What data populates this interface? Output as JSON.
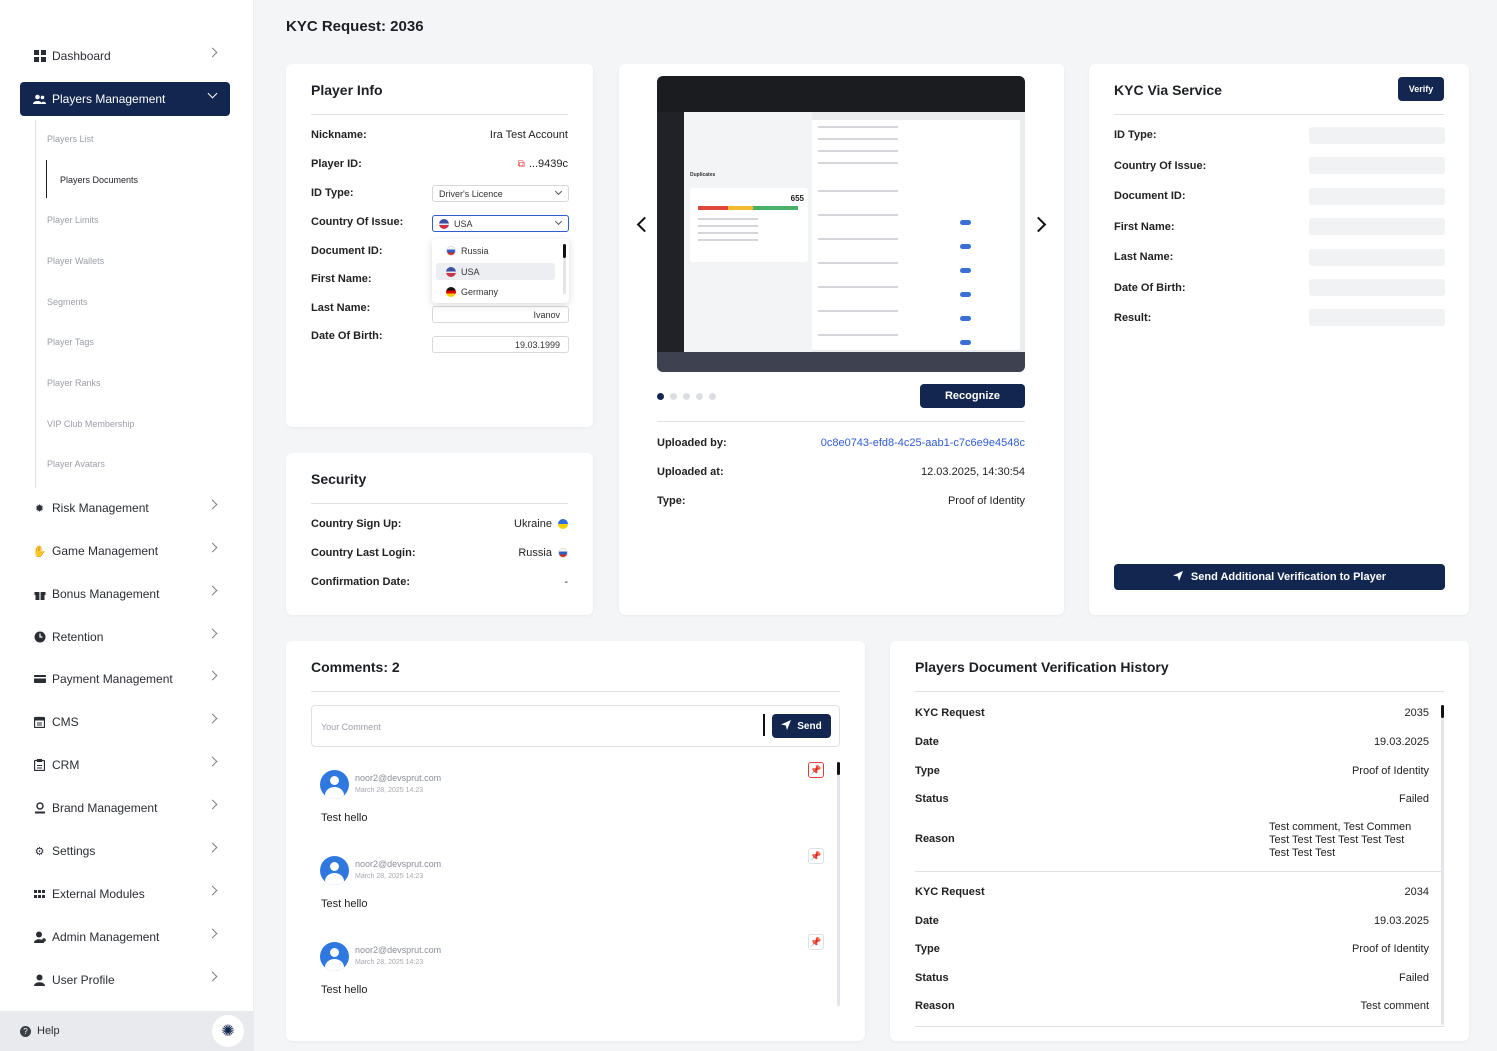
{
  "sidebar": {
    "items": [
      {
        "label": "Dashboard",
        "icon": "grid-icon"
      },
      {
        "label": "Players Management",
        "icon": "users-icon"
      },
      {
        "label": "Risk Management",
        "icon": "gear-icon"
      },
      {
        "label": "Game Management",
        "icon": "hand-icon"
      },
      {
        "label": "Bonus Management",
        "icon": "gift-icon"
      },
      {
        "label": "Retention",
        "icon": "clock-icon"
      },
      {
        "label": "Payment Management",
        "icon": "card-icon"
      },
      {
        "label": "CMS",
        "icon": "calendar-icon"
      },
      {
        "label": "CRM",
        "icon": "clipboard-icon"
      },
      {
        "label": "Brand Management",
        "icon": "person-badge-icon"
      },
      {
        "label": "Settings",
        "icon": "settings-icon"
      },
      {
        "label": "External Modules",
        "icon": "modules-icon"
      },
      {
        "label": "Admin Management",
        "icon": "admin-icon"
      },
      {
        "label": "User Profile",
        "icon": "user-icon"
      }
    ],
    "sub_items": [
      "Players List",
      "Players Documents",
      "Player Limits",
      "Player Wallets",
      "Segments",
      "Player Tags",
      "Player Ranks",
      "VIP Club Membership",
      "Player Avatars"
    ],
    "help_label": "Help"
  },
  "page": {
    "title": "KYC Request: 2036"
  },
  "player_info": {
    "title": "Player Info",
    "nickname_label": "Nickname:",
    "nickname": "Ira Test Account",
    "player_id_label": "Player ID:",
    "player_id": "...9439c",
    "id_type_label": "ID Type:",
    "id_type": "Driver's Licence",
    "country_label": "Country Of Issue:",
    "country": "USA",
    "country_options": [
      "Russia",
      "USA",
      "Germany"
    ],
    "document_id_label": "Document ID:",
    "first_name_label": "First Name:",
    "last_name_label": "Last Name:",
    "last_name": "Ivanov",
    "dob_label": "Date Of Birth:",
    "dob": "19.03.1999"
  },
  "security": {
    "title": "Security",
    "signup_label": "Country Sign Up:",
    "signup": "Ukraine",
    "last_login_label": "Country Last Login:",
    "last_login": "Russia",
    "confirmation_label": "Confirmation Date:",
    "confirmation": "-"
  },
  "document": {
    "preview_counter": "655",
    "preview_heading": "Duplicates",
    "recognize_label": "Recognize",
    "uploaded_by_label": "Uploaded by:",
    "uploaded_by": "0c8e0743-efd8-4c25-aab1-c7c6e9e4548c",
    "uploaded_at_label": "Uploaded at:",
    "uploaded_at": "12.03.2025, 14:30:54",
    "type_label": "Type:",
    "type": "Proof of Identity",
    "active_slide": 1,
    "slide_count": 5
  },
  "kyc_service": {
    "title": "KYC Via Service",
    "verify_label": "Verify",
    "fields": [
      "ID Type:",
      "Country Of Issue:",
      "Document ID:",
      "First Name:",
      "Last Name:",
      "Date Of Birth:",
      "Result:"
    ],
    "send_label": "Send Additional Verification to Player"
  },
  "comments": {
    "title": "Comments: 2",
    "placeholder": "Your Comment",
    "send_label": "Send",
    "items": [
      {
        "email": "noor2@devsprut.com",
        "date": "March 28, 2025 14:23",
        "text": "Test hello",
        "pinned": true
      },
      {
        "email": "noor2@devsprut.com",
        "date": "March 28, 2025 14:23",
        "text": "Test hello",
        "pinned": false
      },
      {
        "email": "noor2@devsprut.com",
        "date": "March 28, 2025 14:23",
        "text": "Test hello",
        "pinned": false
      }
    ]
  },
  "history": {
    "title": "Players Document Verification History",
    "labels": {
      "request": "KYC Request",
      "date": "Date",
      "type": "Type",
      "status": "Status",
      "reason": "Reason"
    },
    "entries": [
      {
        "request": "2035",
        "date": "19.03.2025",
        "type": "Proof of Identity",
        "status": "Failed",
        "reason_lines": [
          "Test comment, Test Commen",
          "Test Test Test Test Test Test",
          "Test Test Test"
        ]
      },
      {
        "request": "2034",
        "date": "19.03.2025",
        "type": "Proof of Identity",
        "status": "Failed",
        "reason_lines": [
          "Test comment"
        ]
      }
    ]
  },
  "colors": {
    "primary": "#12264f",
    "link": "#2f5bd3",
    "danger": "#e23a3a"
  }
}
